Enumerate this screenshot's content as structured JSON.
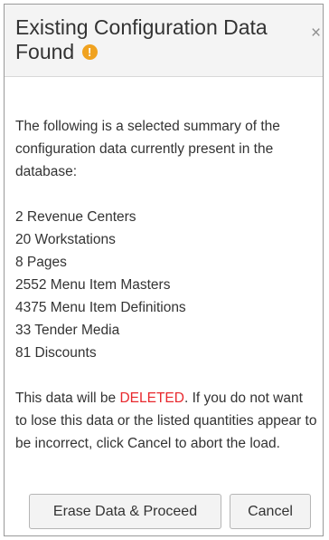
{
  "dialog": {
    "title": "Existing Configuration Data Found",
    "warning_icon_glyph": "!",
    "close_glyph": "×"
  },
  "intro": "The following is a selected summary of the configuration data currently present in the database:",
  "summary_items": [
    "2 Revenue Centers",
    "20 Workstations",
    "8 Pages",
    "2552 Menu Item Masters",
    "4375 Menu Item Definitions",
    "33 Tender Media",
    "81 Discounts"
  ],
  "warning": {
    "before": "This data will be ",
    "highlight": "DELETED",
    "after": ". If you do not want to lose this data or the listed quantities appear to be incorrect, click Cancel to abort the load."
  },
  "buttons": {
    "erase_label": "Erase Data & Proceed",
    "cancel_label": "Cancel"
  },
  "colors": {
    "deleted_text": "#e8282d",
    "warning_icon": "#f0a21f"
  }
}
